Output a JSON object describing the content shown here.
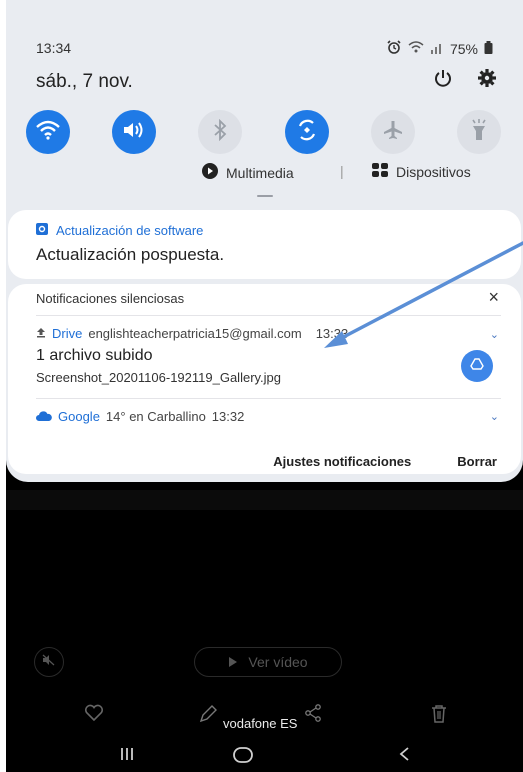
{
  "status": {
    "time": "13:34",
    "battery": "75%"
  },
  "header": {
    "date": "sáb., 7 nov."
  },
  "toggles": [
    {
      "name": "wifi-icon",
      "state": "on"
    },
    {
      "name": "sound-icon",
      "state": "on"
    },
    {
      "name": "bluetooth-icon",
      "state": "off"
    },
    {
      "name": "auto-rotate-icon",
      "state": "on"
    },
    {
      "name": "airplane-mode-icon",
      "state": "off"
    },
    {
      "name": "flashlight-icon",
      "state": "off"
    }
  ],
  "media_row": {
    "multimedia": "Multimedia",
    "separator": "|",
    "devices": "Dispositivos"
  },
  "software_update": {
    "app": "Actualización de software",
    "title": "Actualización pospuesta."
  },
  "silent": {
    "header": "Notificaciones silenciosas",
    "close": "×",
    "drive": {
      "app": "Drive",
      "account": "englishteacherpatricia15@gmail.com",
      "time": "13:33",
      "title": "1 archivo subido",
      "file": "Screenshot_20201106-192119_Gallery.jpg"
    },
    "google": {
      "app": "Google",
      "text": "14° en Carballino",
      "time": "13:32"
    },
    "actions": {
      "settings": "Ajustes notificaciones",
      "clear": "Borrar"
    }
  },
  "background": {
    "video_button": "Ver vídeo",
    "carrier": "vodafone ES"
  },
  "colors": {
    "accent": "#1f7ae6",
    "panel": "#e9ecf1",
    "arrow": "#5b8fd6"
  }
}
